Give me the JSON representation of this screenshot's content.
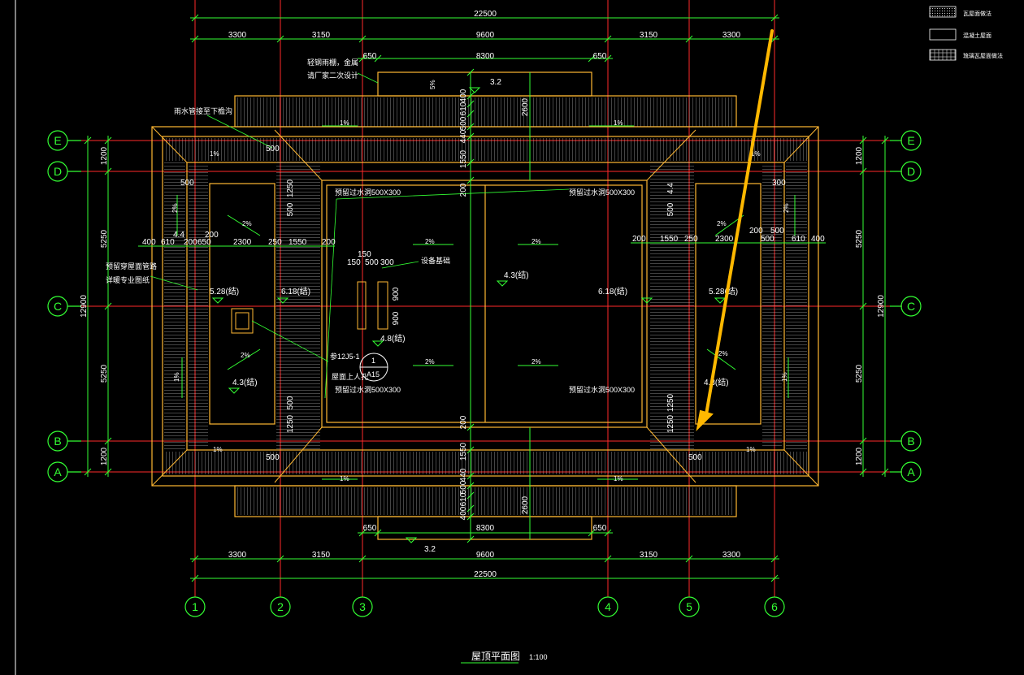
{
  "drawing": {
    "title": "屋顶平面图",
    "scale": "1:100"
  },
  "legend": [
    {
      "pattern": "dots",
      "label": "瓦屋面做法"
    },
    {
      "pattern": "blank",
      "label": "混凝土屋面"
    },
    {
      "pattern": "grid",
      "label": "琉璃瓦屋面做法"
    }
  ],
  "grid_axes": {
    "vertical": [
      "1",
      "2",
      "3",
      "4",
      "5",
      "6"
    ],
    "horizontal": [
      "E",
      "D",
      "C",
      "B",
      "A"
    ]
  },
  "dimensions": {
    "top_total": "22500",
    "top_spans": [
      "3300",
      "3150",
      "9600",
      "3150",
      "3300"
    ],
    "top_upper": [
      "650",
      "8300",
      "650"
    ],
    "bottom_total": "22500",
    "bottom_spans": [
      "3300",
      "3150",
      "9600",
      "3150",
      "3300"
    ],
    "bottom_lower": [
      "650",
      "8300",
      "650"
    ],
    "left_total": "12900",
    "left_spans": [
      "1200",
      "5250",
      "5250",
      "1200"
    ],
    "right_total": "12900",
    "right_spans": [
      "1200",
      "5250",
      "5250",
      "1200"
    ],
    "left_detail": [
      "400",
      "610",
      "200",
      "650",
      "2300",
      "250",
      "1550",
      "200"
    ],
    "right_detail": [
      "200",
      "1550",
      "250",
      "2300",
      "200",
      "500",
      "610",
      "400"
    ],
    "vertical_top": [
      "400",
      "610",
      "500",
      "440",
      "1550",
      "200"
    ],
    "vertical_bottom": [
      "200",
      "1550",
      "440",
      "500",
      "610",
      "400"
    ],
    "misc": [
      "500",
      "500",
      "1250",
      "500",
      "1250",
      "500",
      "2600",
      "2600",
      "4.4",
      "200",
      "150",
      "150",
      "500",
      "300",
      "900",
      "900",
      "500",
      "500",
      "4.4",
      "1250",
      "1250",
      "500"
    ]
  },
  "annotations": {
    "note_top": "轻钢雨棚，金属",
    "note_top2": "请厂家二次设计",
    "note_downpipe": "雨水管接至下檐沟",
    "note_reserve": "预留穿屋面管路",
    "note_reserve2": "详暖专业图纸",
    "equipment_base": "设备基础",
    "overflow_1": "预留过水洞500X300",
    "overflow_2": "预留过水洞500X300",
    "overflow_3": "预留过水洞500X300",
    "overflow_4": "预留过水洞500X300",
    "roof_hatch": "屋面上人孔",
    "detail_ref": "参12J5-1",
    "detail_no": "1",
    "detail_sheet": "A15",
    "elev_32_top": "3.2",
    "elev_32_bottom": "3.2",
    "elev_528_l": "5.28(结)",
    "elev_618_l": "6.18(结)",
    "elev_43_center": "4.3(结)",
    "elev_618_r": "6.18(结)",
    "elev_528_r": "5.28(结)",
    "elev_48": "4.8(结)",
    "elev_43_l": "4.3(结)",
    "elev_43_r": "4.3(结)",
    "slopes": [
      "1%",
      "1%",
      "1%",
      "1%",
      "1%",
      "1%",
      "1%",
      "1%",
      "2%",
      "2%",
      "2%",
      "2%",
      "2%",
      "2%",
      "2%",
      "2%",
      "2%",
      "2%",
      "1%",
      "1%",
      "5%"
    ]
  },
  "colors": {
    "background": "#000000",
    "axis": "#ff2222",
    "dimension": "#33ff33",
    "roof": "#ffb833",
    "hatch": "#cfcfcf",
    "arrow": "#ffb800",
    "text": "#ffffff"
  }
}
